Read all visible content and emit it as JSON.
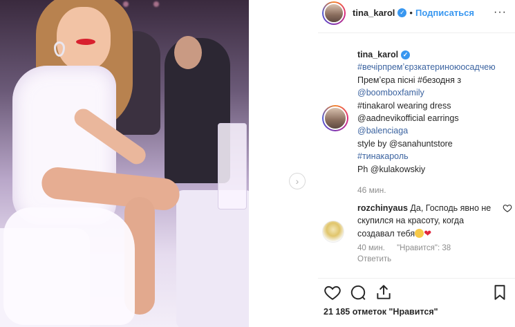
{
  "header": {
    "username": "tina_karol",
    "separator": "•",
    "follow_label": "Подписаться",
    "more": "···"
  },
  "caption": {
    "username": "tina_karol",
    "lines": [
      "#вечірпремʼєрзкатериноюосадчею",
      "Премʼєра пісні #безодня з",
      "@boomboxfamily",
      "#tinakarol wearing dress",
      "@aadnevikofficial earrings",
      "@balenciaga",
      "style by @sanahuntstore",
      "#тинакароль",
      "Ph @kulakowskiy"
    ],
    "time": "46 мин."
  },
  "comment": {
    "username": "rozchinyaus",
    "text_1": "Да, Господь явно не",
    "text_2": "скупился на красоту, когда",
    "text_3": "создавал тебя",
    "time": "40 мин.",
    "likes": "\"Нравится\": 38",
    "reply": "Ответить"
  },
  "likes": {
    "text": "21 185 отметок \"Нравится\""
  },
  "icons": {
    "verified": "verified-badge-icon",
    "next": "chevron-right-icon",
    "like": "heart-icon",
    "comment": "comment-icon",
    "share": "share-icon",
    "save": "bookmark-icon"
  },
  "colors": {
    "link": "#3897f0",
    "tag": "#3b63a0",
    "muted": "#8e8e8e",
    "heart_emoji": "#e0263c"
  }
}
